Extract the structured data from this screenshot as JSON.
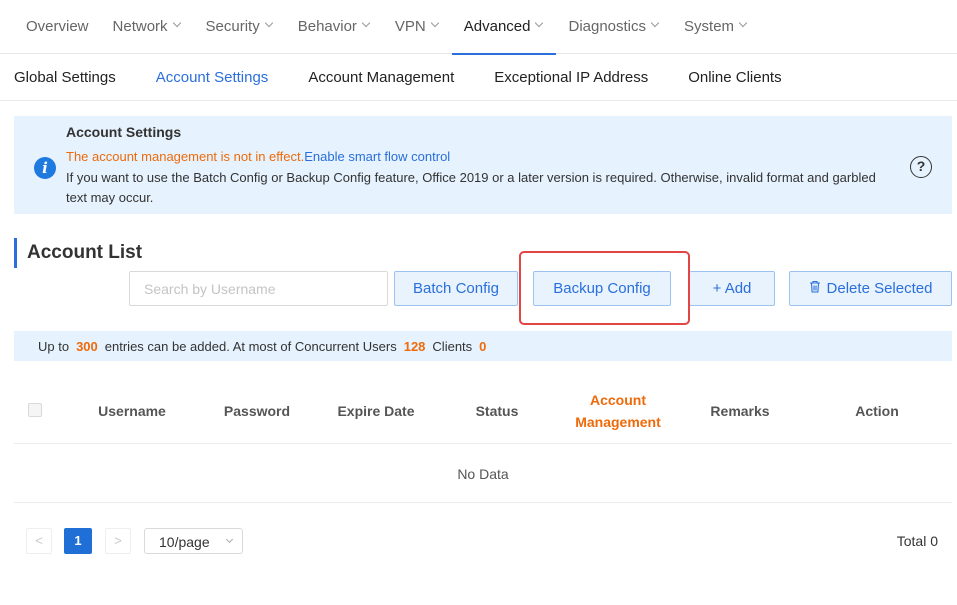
{
  "nav": {
    "items": [
      {
        "label": "Overview",
        "dropdown": false,
        "active": false
      },
      {
        "label": "Network",
        "dropdown": true,
        "active": false
      },
      {
        "label": "Security",
        "dropdown": true,
        "active": false
      },
      {
        "label": "Behavior",
        "dropdown": true,
        "active": false
      },
      {
        "label": "VPN",
        "dropdown": true,
        "active": false
      },
      {
        "label": "Advanced",
        "dropdown": true,
        "active": true
      },
      {
        "label": "Diagnostics",
        "dropdown": true,
        "active": false
      },
      {
        "label": "System",
        "dropdown": true,
        "active": false
      }
    ]
  },
  "subtabs": [
    {
      "label": "Global Settings",
      "active": false
    },
    {
      "label": "Account Settings",
      "active": true
    },
    {
      "label": "Account Management",
      "active": false
    },
    {
      "label": "Exceptional IP Address",
      "active": false
    },
    {
      "label": "Online Clients",
      "active": false
    }
  ],
  "info": {
    "title": "Account Settings",
    "warning": "The account management is not in effect.",
    "link": "Enable smart flow control",
    "description": "If you want to use the Batch Config or Backup Config feature, Office 2019 or a later version is required. Otherwise, invalid format and garbled text may occur.",
    "help_glyph": "?"
  },
  "account_list": {
    "title": "Account List",
    "search_placeholder": "Search by Username",
    "batch_label": "Batch Config",
    "backup_label": "Backup Config",
    "add_label": "+ Add",
    "delete_label": "Delete Selected"
  },
  "notice": {
    "prefix": "Up to",
    "max_entries": "300",
    "middle": "entries can be added. At most of Concurrent Users",
    "concurrent_users": "128",
    "clients_label": "Clients",
    "clients": "0"
  },
  "table": {
    "columns": [
      "Username",
      "Password",
      "Expire Date",
      "Status",
      "Account Management",
      "Remarks",
      "Action"
    ],
    "empty_text": "No Data"
  },
  "pagination": {
    "prev": "<",
    "next": ">",
    "current_page": "1",
    "page_size": "10/page",
    "total": "Total 0"
  },
  "colors": {
    "accent": "#2a6fdb",
    "warning": "#ee6a0a",
    "highlight": "#e34545",
    "info_bg": "#e6f2fd"
  },
  "icons": {
    "info": "info-circle-icon",
    "help": "question-circle-icon",
    "delete": "trash-icon"
  }
}
